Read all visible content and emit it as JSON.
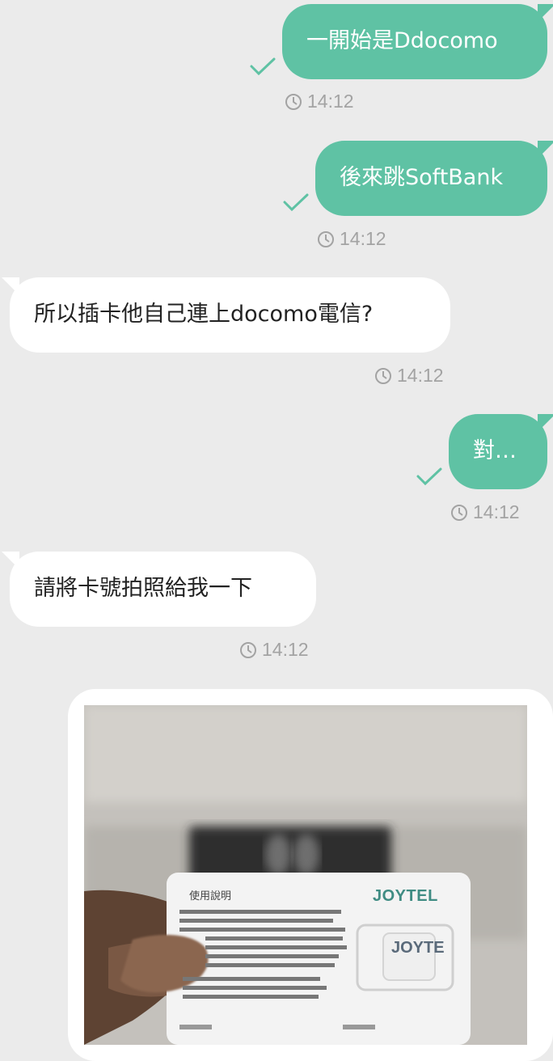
{
  "messages": [
    {
      "dir": "out",
      "text": "一開始是Ddocomo",
      "time": "14:12"
    },
    {
      "dir": "out",
      "text": "後來跳SoftBank",
      "time": "14:12"
    },
    {
      "dir": "in",
      "text": "所以插卡他自己連上docomo電信?",
      "time": "14:12"
    },
    {
      "dir": "out",
      "text": "對…",
      "time": "14:12"
    },
    {
      "dir": "in",
      "text": "請將卡號拍照給我一下",
      "time": "14:12"
    }
  ],
  "photo": {
    "card_title": "使用說明",
    "brand": "JOYTEL",
    "chip_text": "JOYTE",
    "instructions_line1": "1. 抵達目的地插卡，啟用 \"移動數據\" 和 \"數據漫遊\"，\"4G (LTE)\"，即可上網。",
    "instructions_line2": "2. 部分機型如無法上網，請按照說明書設置接入點APN即可。",
    "english_line": "Note: Please switch on mobile data and data roaming after insert your sim card into your phone SIM card slot, and set APN."
  },
  "colors": {
    "outgoing": "#5fc2a4",
    "incoming": "#ffffff",
    "background": "#ebebeb",
    "timestamp": "#a3a3a3"
  }
}
